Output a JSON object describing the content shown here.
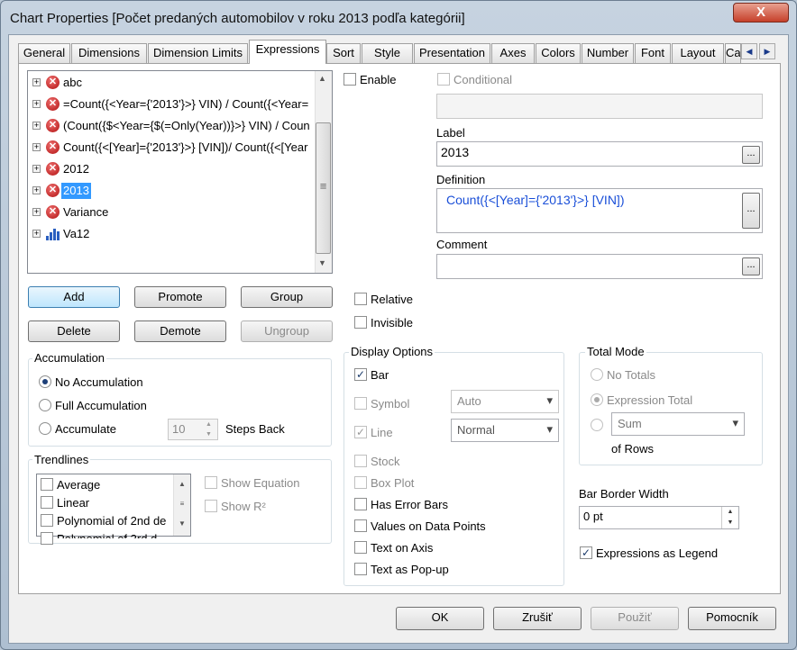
{
  "window": {
    "title": "Chart Properties [Počet predaných automobilov v roku 2013 podľa kategórii]",
    "close": "X"
  },
  "tabs": [
    "General",
    "Dimensions",
    "Dimension Limits",
    "Expressions",
    "Sort",
    "Style",
    "Presentation",
    "Axes",
    "Colors",
    "Number",
    "Font",
    "Layout",
    "Ca"
  ],
  "active_tab": "Expressions",
  "expressions": [
    {
      "label": "abc",
      "icon": "error-icon"
    },
    {
      "label": "=Count({<Year={'2013'}>}  VIN)  /  Count({<Year=",
      "icon": "error-icon"
    },
    {
      "label": "(Count({$<Year={$(=Only(Year))}>}  VIN)  /  Coun",
      "icon": "error-icon"
    },
    {
      "label": "Count({<[Year]={'2013'}>}  [VIN])/  Count({<[Year",
      "icon": "error-icon"
    },
    {
      "label": "2012",
      "icon": "error-icon"
    },
    {
      "label": "2013",
      "icon": "error-icon",
      "selected": true
    },
    {
      "label": "Variance",
      "icon": "error-icon"
    },
    {
      "label": "Va12",
      "icon": "bar-chart-icon"
    }
  ],
  "buttons": {
    "add": "Add",
    "promote": "Promote",
    "group": "Group",
    "delete": "Delete",
    "demote": "Demote",
    "ungroup": "Ungroup"
  },
  "accumulation": {
    "title": "Accumulation",
    "none": "No Accumulation",
    "full": "Full Accumulation",
    "acc": "Accumulate",
    "steps": "10",
    "steps_back": "Steps Back"
  },
  "trendlines": {
    "title": "Trendlines",
    "items": [
      "Average",
      "Linear",
      "Polynomial of 2nd de",
      "Polynomial of 3rd d"
    ],
    "show_equation": "Show Equation",
    "show_r2": "Show R²"
  },
  "enable": "Enable",
  "conditional": "Conditional",
  "label": {
    "title": "Label",
    "value": "2013"
  },
  "definition": {
    "title": "Definition",
    "func": "Count(",
    "rest": "{<[Year]={'2013'}>} [VIN])"
  },
  "comment": {
    "title": "Comment",
    "value": ""
  },
  "relative": "Relative",
  "invisible": "Invisible",
  "display": {
    "title": "Display Options",
    "bar": "Bar",
    "symbol": "Symbol",
    "symbol_value": "Auto",
    "line": "Line",
    "line_value": "Normal",
    "stock": "Stock",
    "box": "Box Plot",
    "error": "Has Error Bars",
    "values": "Values on Data Points",
    "axis": "Text on Axis",
    "popup": "Text as Pop-up"
  },
  "total": {
    "title": "Total Mode",
    "none": "No Totals",
    "expr": "Expression Total",
    "sum": "Sum",
    "of_rows": "of Rows"
  },
  "bar_border": {
    "title": "Bar Border Width",
    "value": "0 pt"
  },
  "legend": "Expressions as Legend",
  "footer": {
    "ok": "OK",
    "cancel": "Zrušiť",
    "apply": "Použiť",
    "help": "Pomocník"
  },
  "colors": {
    "selection": "#3399ff",
    "definition_func": "#1a4fd8"
  }
}
